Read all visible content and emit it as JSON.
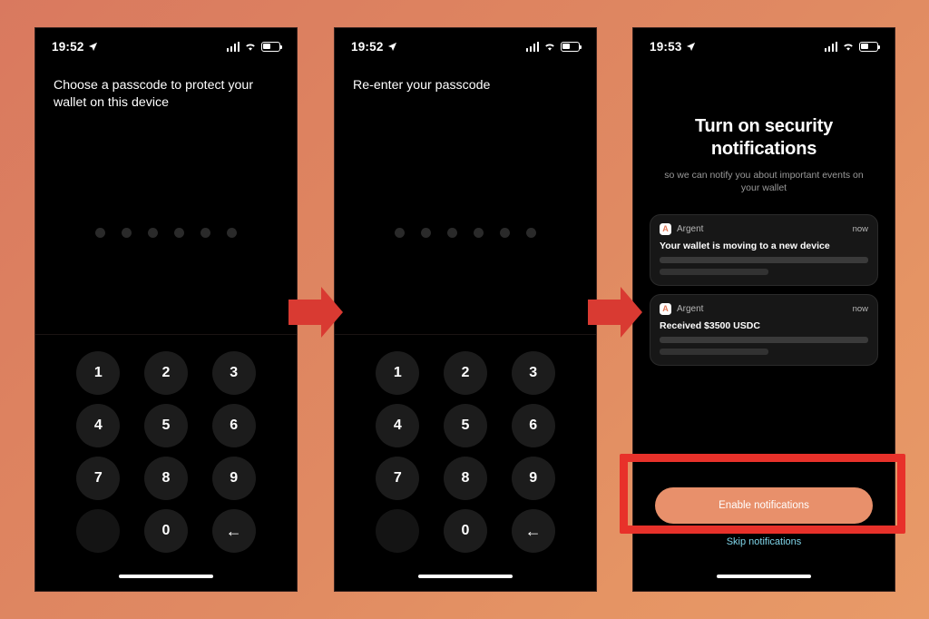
{
  "background": {
    "gradient_from": "#d9795f",
    "gradient_to": "#e89a68"
  },
  "accent": {
    "red_arrow": "#d93a32",
    "red_highlight": "#e8312a",
    "brand_orange": "#e8906b",
    "link_blue": "#7fd4e8"
  },
  "phones": [
    {
      "id": "phone-1",
      "status_bar": {
        "time": "19:52",
        "location_icon": "location-arrow-icon",
        "signal_icon": "cellular-signal-icon",
        "wifi_icon": "wifi-icon",
        "battery_icon": "battery-icon"
      },
      "prompt": "Choose a passcode to protect your wallet on this device",
      "passcode_dots": 6,
      "keypad": [
        "1",
        "2",
        "3",
        "4",
        "5",
        "6",
        "7",
        "8",
        "9",
        "",
        "0",
        "←"
      ]
    },
    {
      "id": "phone-2",
      "status_bar": {
        "time": "19:52",
        "location_icon": "location-arrow-icon",
        "signal_icon": "cellular-signal-icon",
        "wifi_icon": "wifi-icon",
        "battery_icon": "battery-icon"
      },
      "prompt": "Re-enter your passcode",
      "passcode_dots": 6,
      "keypad": [
        "1",
        "2",
        "3",
        "4",
        "5",
        "6",
        "7",
        "8",
        "9",
        "",
        "0",
        "←"
      ]
    },
    {
      "id": "phone-3",
      "status_bar": {
        "time": "19:53",
        "location_icon": "location-arrow-icon",
        "signal_icon": "cellular-signal-icon",
        "wifi_icon": "wifi-icon",
        "battery_icon": "battery-icon"
      },
      "title": "Turn on security notifications",
      "subtitle": "so we can notify you about important events on your wallet",
      "notifications": [
        {
          "app_icon_letter": "A",
          "app": "Argent",
          "time": "now",
          "title": "Your wallet is moving to a new device"
        },
        {
          "app_icon_letter": "A",
          "app": "Argent",
          "time": "now",
          "title": "Received $3500 USDC"
        }
      ],
      "primary_button": "Enable notifications",
      "skip_link": "Skip notifications"
    }
  ],
  "arrows": [
    {
      "name": "flow-arrow-1",
      "direction": "right"
    },
    {
      "name": "flow-arrow-2",
      "direction": "right"
    }
  ]
}
